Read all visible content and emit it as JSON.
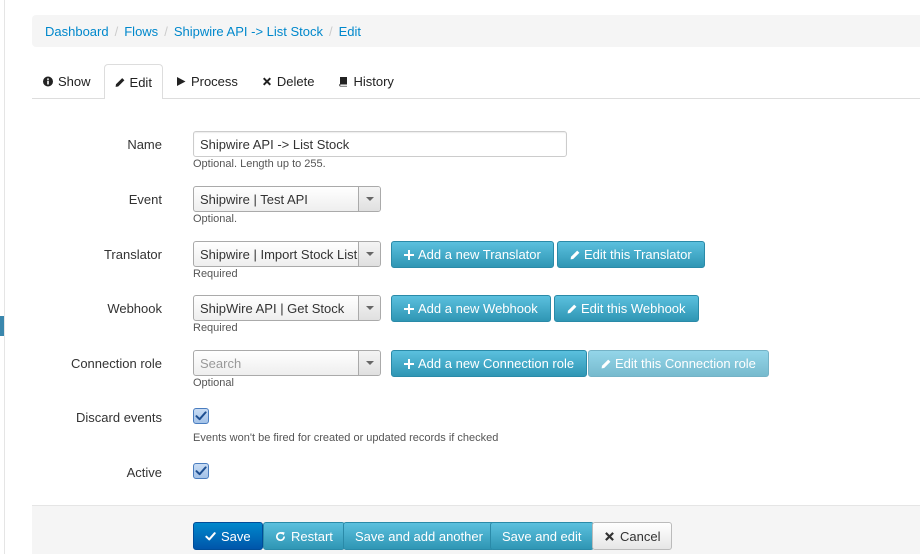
{
  "breadcrumb": {
    "items": [
      "Dashboard",
      "Flows",
      "Shipwire API -> List Stock",
      "Edit"
    ],
    "separator": "/"
  },
  "tabs": [
    {
      "label": "Show",
      "icon": "info-sign-icon"
    },
    {
      "label": "Edit",
      "icon": "pencil-icon",
      "active": true
    },
    {
      "label": "Process",
      "icon": "play-icon"
    },
    {
      "label": "Delete",
      "icon": "remove-icon"
    },
    {
      "label": "History",
      "icon": "book-icon"
    }
  ],
  "form": {
    "name": {
      "label": "Name",
      "value": "Shipwire API -> List Stock",
      "help": "Optional. Length up to 255."
    },
    "event": {
      "label": "Event",
      "value": "Shipwire | Test API",
      "help": "Optional."
    },
    "translator": {
      "label": "Translator",
      "value": "Shipwire | Import Stock List",
      "help": "Required",
      "add_label": "Add a new Translator",
      "edit_label": "Edit this Translator"
    },
    "webhook": {
      "label": "Webhook",
      "value": "ShipWire API | Get Stock",
      "help": "Required",
      "add_label": "Add a new Webhook",
      "edit_label": "Edit this Webhook"
    },
    "connection_role": {
      "label": "Connection role",
      "placeholder": "Search",
      "help": "Optional",
      "add_label": "Add a new Connection role",
      "edit_label": "Edit this Connection role",
      "edit_disabled": true
    },
    "discard_events": {
      "label": "Discard events",
      "checked": true,
      "help": "Events won't be fired for created or updated records if checked"
    },
    "active": {
      "label": "Active",
      "checked": true
    }
  },
  "actions": {
    "save": "Save",
    "restart": "Restart",
    "save_add_another": "Save and add another",
    "save_edit": "Save and edit",
    "cancel": "Cancel"
  },
  "colors": {
    "link": "#0088cc",
    "primary": "#0077cc",
    "info": "#49afcd",
    "checkbox": "#a3c2e8"
  }
}
